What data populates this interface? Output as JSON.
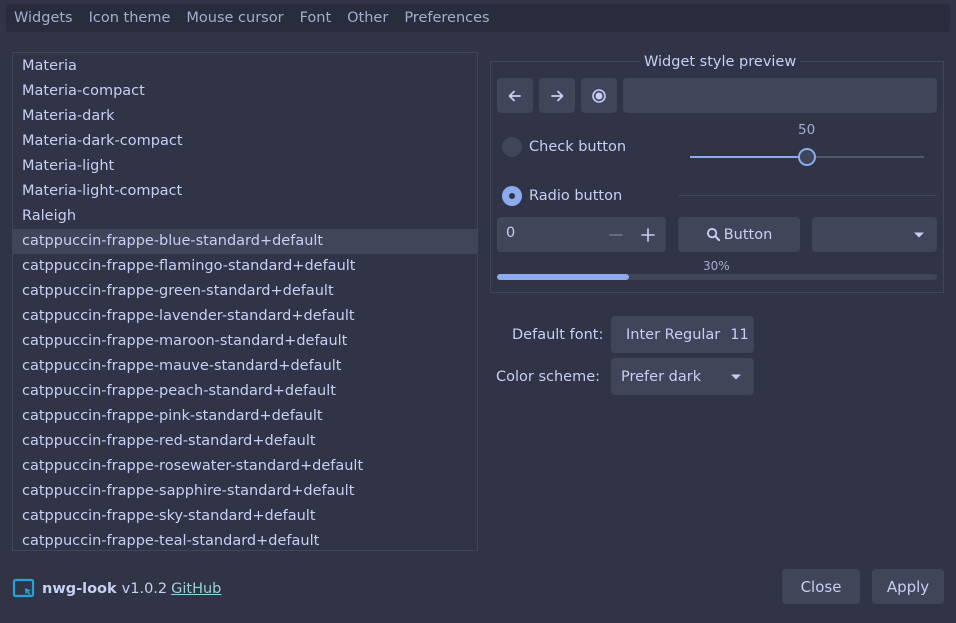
{
  "tabs": [
    "Widgets",
    "Icon theme",
    "Mouse cursor",
    "Font",
    "Other",
    "Preferences"
  ],
  "theme_list": [
    "Materia",
    "Materia-compact",
    "Materia-dark",
    "Materia-dark-compact",
    "Materia-light",
    "Materia-light-compact",
    "Raleigh",
    "catppuccin-frappe-blue-standard+default",
    "catppuccin-frappe-flamingo-standard+default",
    "catppuccin-frappe-green-standard+default",
    "catppuccin-frappe-lavender-standard+default",
    "catppuccin-frappe-maroon-standard+default",
    "catppuccin-frappe-mauve-standard+default",
    "catppuccin-frappe-peach-standard+default",
    "catppuccin-frappe-pink-standard+default",
    "catppuccin-frappe-red-standard+default",
    "catppuccin-frappe-rosewater-standard+default",
    "catppuccin-frappe-sapphire-standard+default",
    "catppuccin-frappe-sky-standard+default",
    "catppuccin-frappe-teal-standard+default"
  ],
  "selected_theme": "catppuccin-frappe-blue-standard+default",
  "preview": {
    "title": "Widget style preview",
    "check_label": "Check button",
    "radio_label": "Radio button",
    "slider_value": "50",
    "slider_fraction": 0.5,
    "spin_value": "0",
    "button_label": "Button",
    "progress_text": "30%",
    "progress_fraction": 0.3
  },
  "settings": {
    "font_label": "Default font:",
    "font_name": "Inter Regular",
    "font_size": "11",
    "scheme_label": "Color scheme:",
    "scheme_value": "Prefer dark"
  },
  "footer": {
    "app_name": "nwg-look",
    "version": "v1.0.2",
    "link": "GitHub",
    "close_label": "Close",
    "apply_label": "Apply"
  },
  "colors": {
    "background": "#303446",
    "accent": "#8caaee",
    "surface": "#414559",
    "link": "#99d1db"
  },
  "icons": [
    "arrow-left-icon",
    "arrow-right-icon",
    "record-icon",
    "minus-icon",
    "plus-icon",
    "search-icon",
    "chevron-down-icon",
    "app-logo-icon"
  ]
}
